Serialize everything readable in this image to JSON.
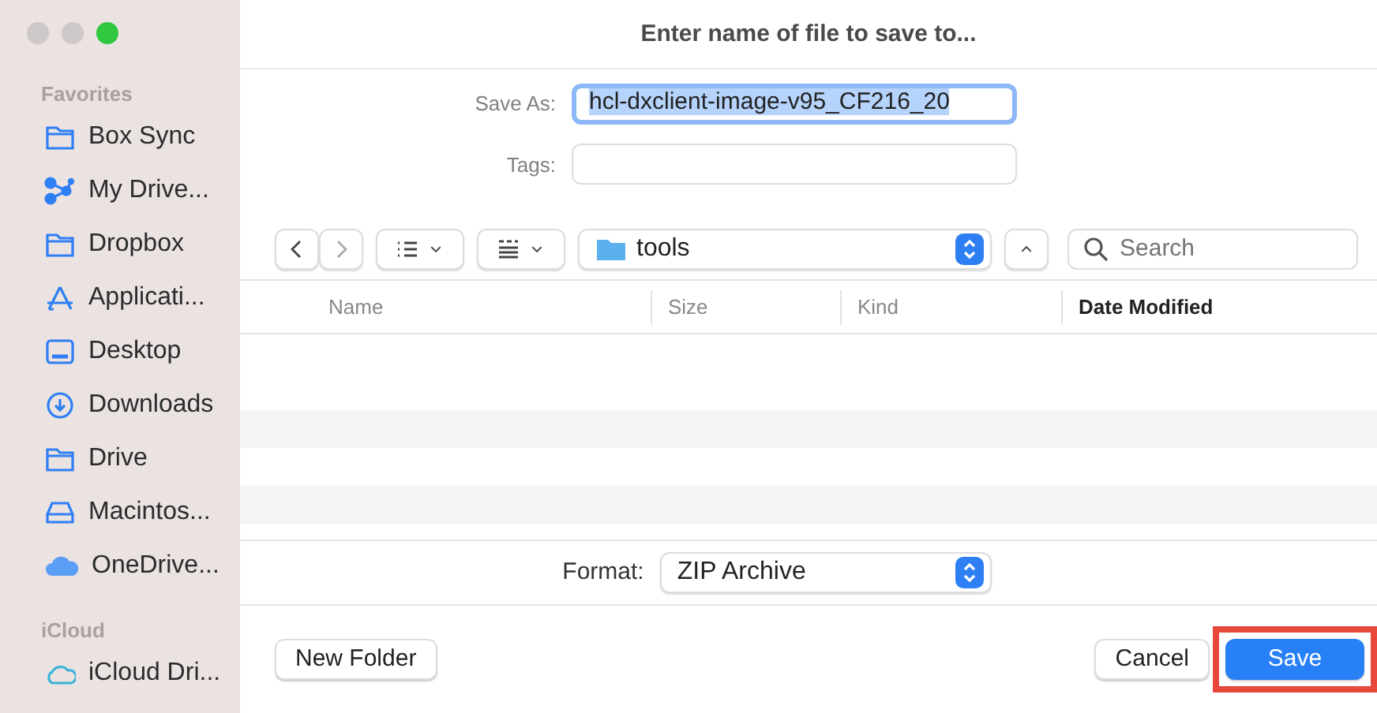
{
  "window": {
    "title": "Enter name of file to save to..."
  },
  "sidebar": {
    "sections": [
      {
        "heading": "Favorites",
        "items": [
          {
            "label": "Box Sync",
            "kind": "folder"
          },
          {
            "label": "My Drive...",
            "kind": "network"
          },
          {
            "label": "Dropbox",
            "kind": "folder"
          },
          {
            "label": "Applicati...",
            "kind": "apps"
          },
          {
            "label": "Desktop",
            "kind": "desktop"
          },
          {
            "label": "Downloads",
            "kind": "download"
          },
          {
            "label": "Drive",
            "kind": "folder"
          },
          {
            "label": "Macintos...",
            "kind": "disk"
          },
          {
            "label": "OneDrive...",
            "kind": "cloud"
          }
        ]
      },
      {
        "heading": "iCloud",
        "items": [
          {
            "label": "iCloud Dri...",
            "kind": "cloud-outline"
          }
        ]
      }
    ]
  },
  "save_as": {
    "label": "Save As:",
    "value": "hcl-dxclient-image-v95_CF216_20"
  },
  "tags": {
    "label": "Tags:"
  },
  "location": {
    "folder": "tools"
  },
  "search": {
    "placeholder": "Search"
  },
  "table": {
    "columns": [
      {
        "label": "Name",
        "selected": false
      },
      {
        "label": "Size",
        "selected": false
      },
      {
        "label": "Kind",
        "selected": false
      },
      {
        "label": "Date Modified",
        "selected": true
      }
    ]
  },
  "format": {
    "label": "Format:",
    "value": "ZIP Archive"
  },
  "buttons": {
    "new_folder": "New Folder",
    "cancel": "Cancel",
    "save": {
      "label": "Save",
      "highlighted": true
    }
  }
}
